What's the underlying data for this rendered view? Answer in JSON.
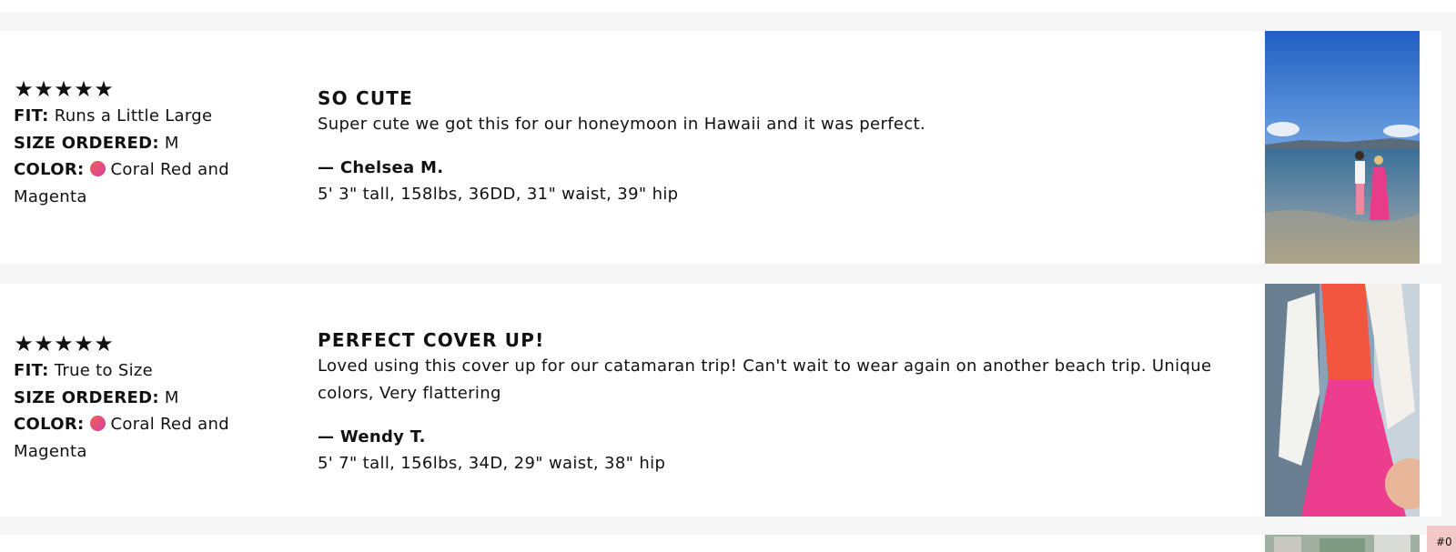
{
  "colors": {
    "swatch_coral": "#f2604a",
    "swatch_magenta": "#d43fa8"
  },
  "reviews": [
    {
      "stars": "★★★★★",
      "rating": 5,
      "fit_label": "FIT:",
      "fit_value": "Runs a Little Large",
      "size_label": "SIZE ORDERED:",
      "size_value": "M",
      "color_label": "COLOR:",
      "color_value": "Coral Red and Magenta",
      "title": "SO CUTE",
      "text": "Super cute we got this for our honeymoon in Hawaii and it was perfect.",
      "author": "— Chelsea M.",
      "measurements": "5' 3\" tall, 158lbs, 36DD, 31\" waist, 39\" hip"
    },
    {
      "stars": "★★★★★",
      "rating": 5,
      "fit_label": "FIT:",
      "fit_value": "True to Size",
      "size_label": "SIZE ORDERED:",
      "size_value": "M",
      "color_label": "COLOR:",
      "color_value": "Coral Red and Magenta",
      "title": "PERFECT COVER UP!",
      "text": "Loved using this cover up for our catamaran trip! Can't wait to wear again on another beach trip. Unique colors, Very flattering",
      "author": "— Wendy T.",
      "measurements": "5' 7\" tall, 156lbs, 34D, 29\" waist, 38\" hip"
    }
  ],
  "corner_tab": {
    "text": "#0"
  }
}
